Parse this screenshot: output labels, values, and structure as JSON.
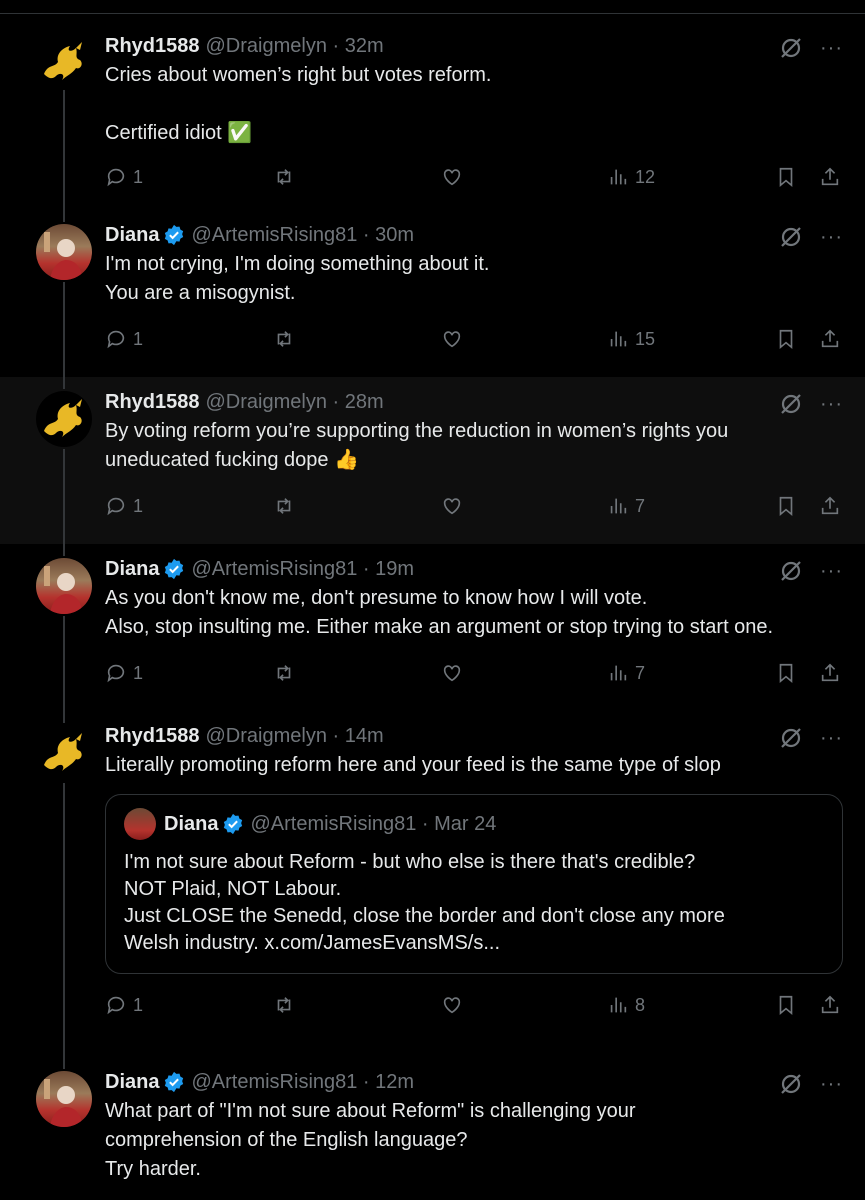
{
  "tweets": [
    {
      "name": "Rhyd1588",
      "handle": "@Draigmelyn · 32m",
      "text": "Cries about women’s right but votes reform.\n\nCertified idiot ✅",
      "replies": "1",
      "views": "12",
      "avatar": "welsh-dragon-avatar",
      "verified": false
    },
    {
      "name": "Diana",
      "handle": "@ArtemisRising81 · 30m",
      "text": "I'm not crying, I'm doing something about it.\nYou are a misogynist.",
      "replies": "1",
      "views": "15",
      "avatar": "person-avatar",
      "verified": true
    },
    {
      "name": "Rhyd1588",
      "handle": "@Draigmelyn · 28m",
      "text": "By voting reform you’re supporting the reduction in women’s rights you\nuneducated fucking dope 👍",
      "replies": "1",
      "views": "7",
      "avatar": "welsh-dragon-avatar",
      "verified": false
    },
    {
      "name": "Diana",
      "handle": "@ArtemisRising81 · 19m",
      "text": "As you don't know me, don't presume to know how I will vote.\nAlso, stop insulting me. Either make an argument or stop trying to start one.",
      "replies": "1",
      "views": "7",
      "avatar": "person-avatar",
      "verified": true
    },
    {
      "name": "Rhyd1588",
      "handle": "@Draigmelyn · 14m",
      "text": "Literally promoting reform here and your feed is the same type of slop",
      "replies": "1",
      "views": "8",
      "avatar": "welsh-dragon-avatar",
      "verified": false,
      "quote": {
        "name": "Diana",
        "handle": "@ArtemisRising81 · Mar 24",
        "text": "I'm not sure about Reform - but who else is there that's credible?\nNOT Plaid, NOT Labour.\nJust CLOSE the Senedd, close the border and don't close any more\nWelsh industry. x.com/JamesEvansMS/s..."
      }
    },
    {
      "name": "Diana",
      "handle": "@ArtemisRising81 · 12m",
      "text": "What part of \"I'm not sure about Reform\" is challenging your\ncomprehension of the English language?\nTry harder.",
      "avatar": "person-avatar",
      "verified": true
    }
  ],
  "more_label": "···",
  "colors": {
    "verified": "#1d9bf0",
    "muted": "#71767b",
    "text": "#e7e9ea",
    "background": "#000000"
  }
}
